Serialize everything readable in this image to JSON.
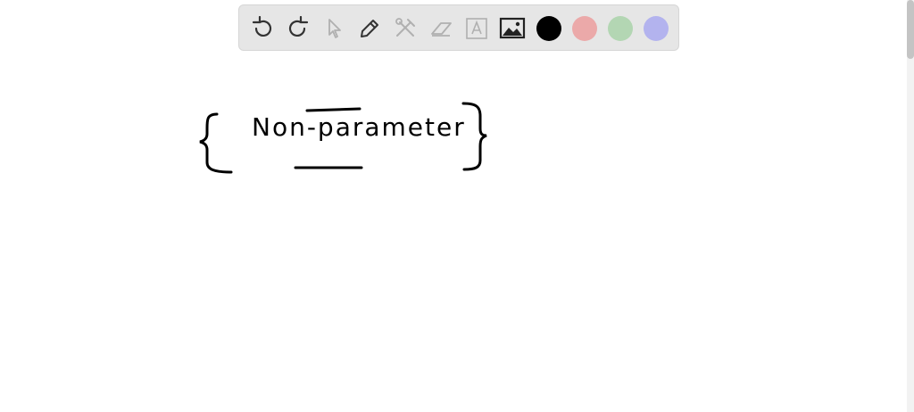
{
  "toolbar": {
    "tools": [
      {
        "name": "undo-icon"
      },
      {
        "name": "redo-icon"
      },
      {
        "name": "pointer-icon"
      },
      {
        "name": "pencil-icon"
      },
      {
        "name": "tools-icon"
      },
      {
        "name": "eraser-icon"
      },
      {
        "name": "text-box-icon"
      },
      {
        "name": "image-icon"
      }
    ],
    "colors": [
      "#000000",
      "#eba9a9",
      "#b3d6b3",
      "#b3b3ee"
    ],
    "selected_color": "#000000"
  },
  "canvas": {
    "handwriting": "Non-parameter"
  }
}
